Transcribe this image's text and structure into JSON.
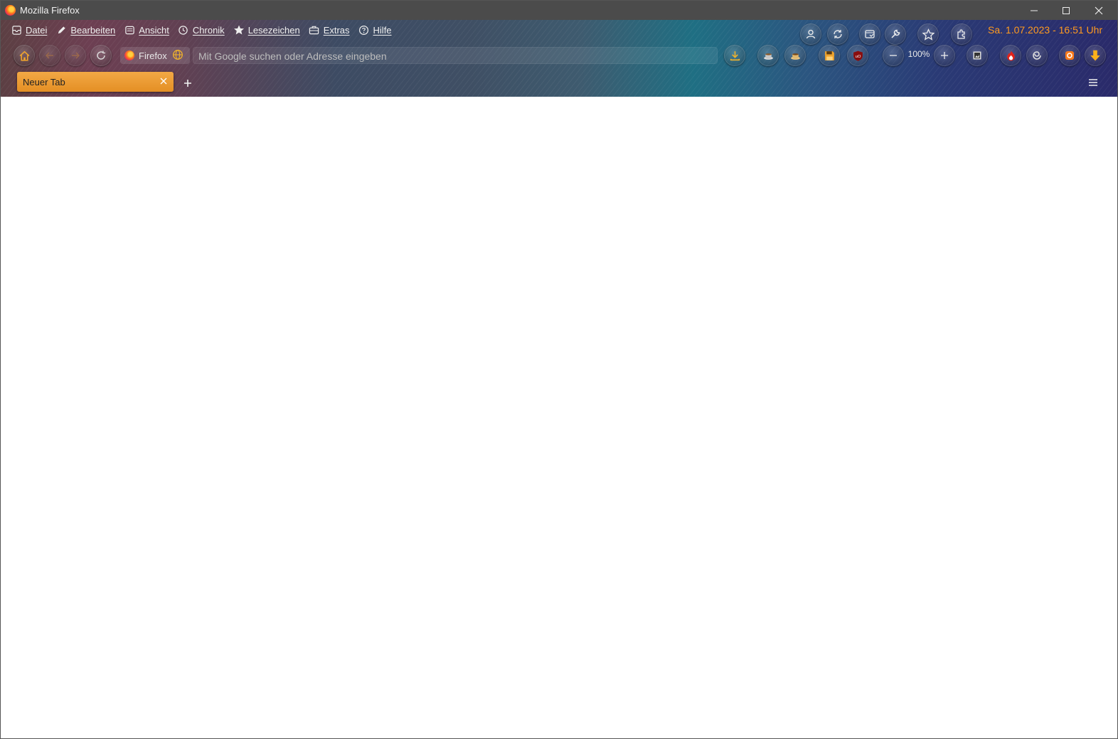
{
  "window": {
    "title": "Mozilla Firefox"
  },
  "menubar": {
    "items": [
      {
        "label": "Datei",
        "icon": "file-icon"
      },
      {
        "label": "Bearbeiten",
        "icon": "pencil-icon"
      },
      {
        "label": "Ansicht",
        "icon": "view-icon"
      },
      {
        "label": "Chronik",
        "icon": "clock-icon"
      },
      {
        "label": "Lesezeichen",
        "icon": "star-icon"
      },
      {
        "label": "Extras",
        "icon": "toolbox-icon"
      },
      {
        "label": "Hilfe",
        "icon": "help-icon"
      }
    ]
  },
  "clock": {
    "text": "Sa. 1.07.2023 - 16:51 Uhr",
    "color": "#ff9a1f"
  },
  "navbar": {
    "identity_label": "Firefox",
    "url_placeholder": "Mit Google suchen oder Adresse eingeben",
    "url_value": "",
    "zoom_level": "100%"
  },
  "tabs": [
    {
      "label": "Neuer Tab",
      "active": true
    }
  ],
  "colors": {
    "accent": "#e48f24",
    "titlebar": "#4b4b4b"
  }
}
